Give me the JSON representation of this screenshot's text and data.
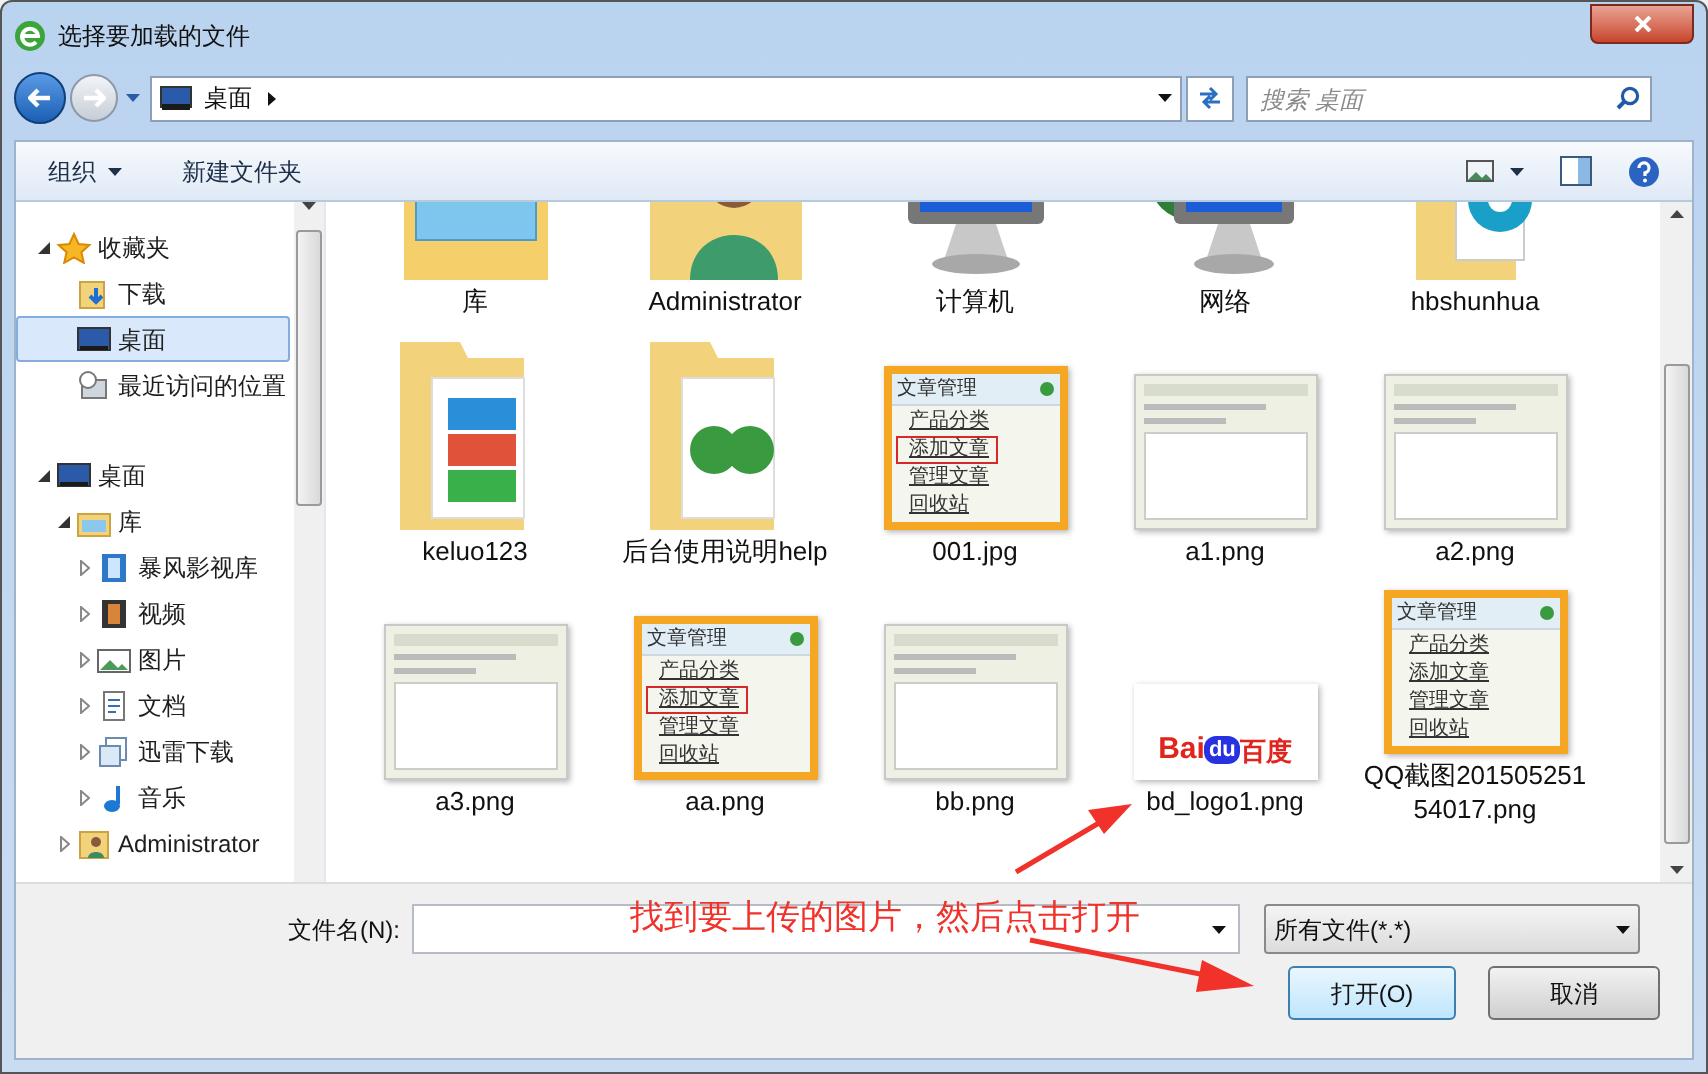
{
  "window": {
    "title": "选择要加载的文件"
  },
  "nav": {
    "path": "桌面",
    "search_placeholder": "搜索 桌面"
  },
  "toolbar": {
    "organize": "组织",
    "new_folder": "新建文件夹"
  },
  "sidebar": {
    "items": [
      {
        "label": "收藏夹",
        "kind": "star",
        "expanded": true,
        "selected": false,
        "children": [
          {
            "label": "下载",
            "kind": "download",
            "selected": false
          },
          {
            "label": "桌面",
            "kind": "desktop",
            "selected": true
          },
          {
            "label": "最近访问的位置",
            "kind": "recent",
            "selected": false
          }
        ]
      },
      {
        "label": "桌面",
        "kind": "desktop",
        "expanded": true,
        "selected": false,
        "children": [
          {
            "label": "库",
            "kind": "library",
            "expanded": true,
            "selected": false,
            "children": [
              {
                "label": "暴风影视库",
                "kind": "video",
                "expanded": false,
                "selected": false
              },
              {
                "label": "视频",
                "kind": "film",
                "expanded": false,
                "selected": false
              },
              {
                "label": "图片",
                "kind": "picture",
                "expanded": false,
                "selected": false
              },
              {
                "label": "文档",
                "kind": "document",
                "expanded": false,
                "selected": false
              },
              {
                "label": "迅雷下载",
                "kind": "download-lib",
                "expanded": false,
                "selected": false
              },
              {
                "label": "音乐",
                "kind": "music",
                "expanded": false,
                "selected": false
              }
            ]
          },
          {
            "label": "Administrator",
            "kind": "user",
            "expanded": false,
            "selected": false
          }
        ]
      }
    ]
  },
  "files": [
    {
      "name": "库",
      "kind": "library"
    },
    {
      "name": "Administrator",
      "kind": "user-folder"
    },
    {
      "name": "计算机",
      "kind": "computer"
    },
    {
      "name": "网络",
      "kind": "network"
    },
    {
      "name": "hbshunhua",
      "kind": "media-folder"
    },
    {
      "name": "keluo123",
      "kind": "zip-folder"
    },
    {
      "name": "后台使用说明help",
      "kind": "doc-folder"
    },
    {
      "name": "001.jpg",
      "kind": "menu-card",
      "title": "文章管理",
      "items": [
        {
          "label": "产品分类",
          "highlighted": false
        },
        {
          "label": "添加文章",
          "highlighted": true
        },
        {
          "label": "管理文章",
          "highlighted": false
        },
        {
          "label": "回收站",
          "highlighted": false
        }
      ]
    },
    {
      "name": "a1.png",
      "kind": "screenshot"
    },
    {
      "name": "a2.png",
      "kind": "screenshot"
    },
    {
      "name": "a3.png",
      "kind": "screenshot"
    },
    {
      "name": "aa.png",
      "kind": "menu-card",
      "title": "文章管理",
      "items": [
        {
          "label": "产品分类",
          "highlighted": false
        },
        {
          "label": "添加文章",
          "highlighted": true
        },
        {
          "label": "管理文章",
          "highlighted": false
        },
        {
          "label": "回收站",
          "highlighted": false
        }
      ]
    },
    {
      "name": "bb.png",
      "kind": "screenshot"
    },
    {
      "name": "bd_logo1.png",
      "kind": "logo",
      "parts": [
        "Bai",
        "du",
        "百度"
      ]
    },
    {
      "name": "QQ截图20150525154017.png",
      "kind": "menu-card",
      "title": "文章管理",
      "items": [
        {
          "label": "产品分类",
          "highlighted": false
        },
        {
          "label": "添加文章",
          "highlighted": false
        },
        {
          "label": "管理文章",
          "highlighted": false
        },
        {
          "label": "回收站",
          "highlighted": false
        }
      ]
    }
  ],
  "bottom": {
    "filename_label": "文件名(N):",
    "filetype": "所有文件(*.*)",
    "open": "打开(O)",
    "cancel": "取消"
  },
  "annotation": {
    "text": "找到要上传的图片，然后点击打开"
  }
}
